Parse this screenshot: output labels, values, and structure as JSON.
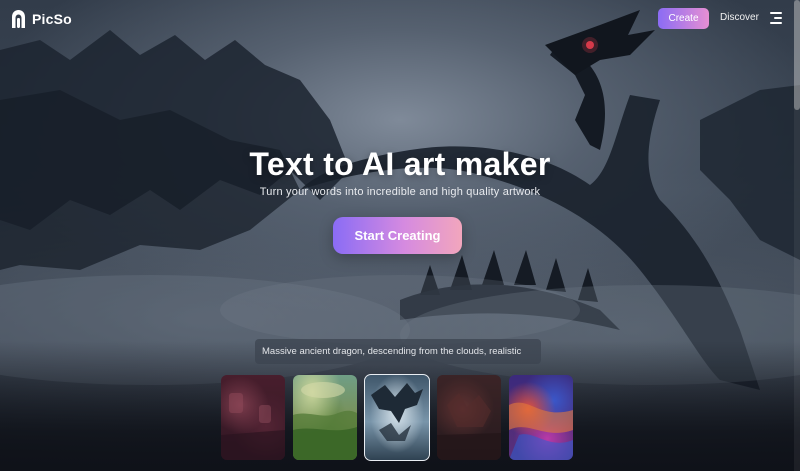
{
  "header": {
    "brand": "PicSo",
    "create_label": "Create",
    "discover_label": "Discover",
    "menu_icon": "hamburger-menu-icon"
  },
  "hero": {
    "title": "Text to AI art maker",
    "subtitle": "Turn your words into incredible and high quality artwork",
    "cta_label": "Start Creating"
  },
  "prompt": {
    "text": "Massive ancient dragon, descending from the clouds, realistic"
  },
  "thumbnails": [
    {
      "name": "thumbnail-1",
      "active": false
    },
    {
      "name": "thumbnail-2",
      "active": false
    },
    {
      "name": "thumbnail-3",
      "active": true
    },
    {
      "name": "thumbnail-4",
      "active": false
    },
    {
      "name": "thumbnail-5",
      "active": false
    }
  ],
  "colors": {
    "accent_start": "#8b6cf4",
    "accent_end": "#e68fd3",
    "background": "#1b2430"
  }
}
